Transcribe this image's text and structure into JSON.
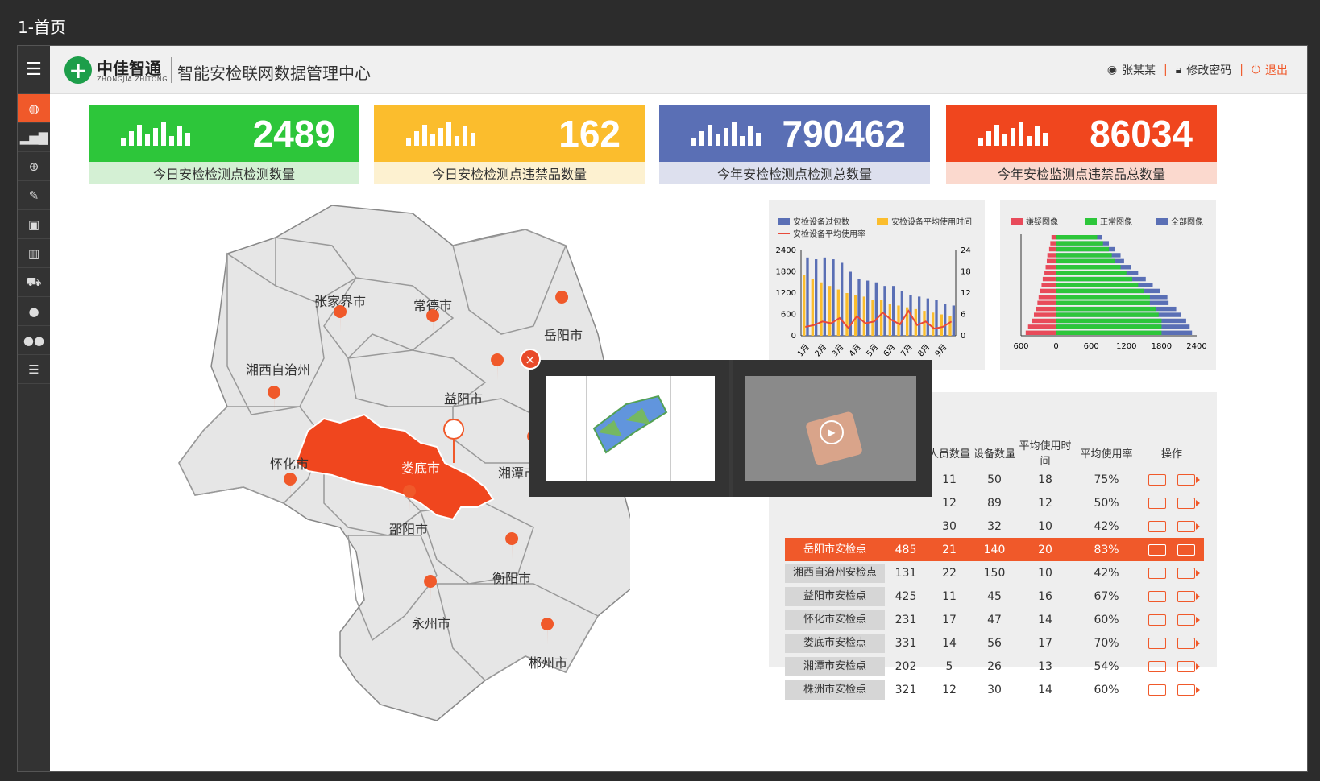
{
  "page_label": "1-首页",
  "header": {
    "logo_cn": "中佳智通",
    "logo_en": "ZHONGJIA ZHITONG",
    "system_title": "智能安检联网数据管理中心",
    "user_name": "张某某",
    "change_password": "修改密码",
    "logout": "退出"
  },
  "stats": [
    {
      "value": "2489",
      "label": "今日安检检测点检测数量",
      "color": "#2dc63a",
      "light": "#d4f0d4"
    },
    {
      "value": "162",
      "label": "今日安检检测点违禁品数量",
      "color": "#fbbd2d",
      "light": "#fdf1d0"
    },
    {
      "value": "790462",
      "label": "今年安检检测点检测总数量",
      "color": "#5a6fb5",
      "light": "#dde0ee"
    },
    {
      "value": "86034",
      "label": "今年安检监测点违禁品总数量",
      "color": "#f0461e",
      "light": "#fbd9ce"
    }
  ],
  "map": {
    "cities": [
      "张家界市",
      "常德市",
      "岳阳市",
      "湘西自治州",
      "益阳市",
      "怀化市",
      "娄底市",
      "湘潭市",
      "邵阳市",
      "衡阳市",
      "永州市",
      "郴州市"
    ],
    "selected": "娄底市",
    "highlight_color": "#f0461e"
  },
  "chart_data": [
    {
      "type": "bar",
      "legend": [
        "安检设备过包数",
        "安检设备平均使用时间",
        "安检设备平均使用率"
      ],
      "categories": [
        "1月",
        "2月",
        "3月",
        "4月",
        "5月",
        "6月",
        "7月",
        "8月",
        "9月"
      ],
      "series": [
        {
          "name": "安检设备过包数",
          "values": [
            2200,
            2150,
            2200,
            2150,
            2050,
            1800,
            1600,
            1550,
            1500,
            1400,
            1400,
            1250,
            1150,
            1100,
            1050,
            1000,
            900,
            850
          ],
          "color": "#5a6fb5"
        },
        {
          "name": "安检设备平均使用时间",
          "values": [
            17,
            16,
            15,
            14,
            13,
            12,
            11.5,
            11,
            10,
            10,
            9,
            8.5,
            8,
            7.5,
            7,
            6.5,
            6,
            5.5
          ],
          "color": "#fbbd2d"
        },
        {
          "name": "安检设备平均使用率",
          "values": [
            2.5,
            3,
            4,
            3.5,
            5,
            2.2,
            5.5,
            3.5,
            4,
            6.5,
            4.5,
            3.2,
            7,
            3,
            4,
            2,
            2.5,
            4
          ],
          "color": "#e84a3a"
        }
      ],
      "ylim_left": [
        0,
        2400
      ],
      "yticks_left": [
        "0",
        "600",
        "1200",
        "1800",
        "2400"
      ],
      "ylim_right": [
        0,
        24
      ],
      "yticks_right": [
        "0",
        "6",
        "12",
        "18",
        "24"
      ]
    },
    {
      "type": "bar",
      "orientation": "horizontal",
      "legend": [
        "嫌疑图像",
        "正常图像",
        "全部图像"
      ],
      "xticks": [
        "600",
        "0",
        "600",
        "1200",
        "1800",
        "2400"
      ],
      "series": [
        {
          "name": "嫌疑图像",
          "values": [
            -80,
            -100,
            -120,
            -150,
            -160,
            -180,
            -200,
            -230,
            -250,
            -280,
            -300,
            -320,
            -350,
            -380,
            -420,
            -480,
            -520
          ],
          "color": "#e84a5a"
        },
        {
          "name": "正常图像",
          "values": [
            700,
            800,
            900,
            950,
            1000,
            1100,
            1200,
            1300,
            1400,
            1500,
            1600,
            1600,
            1700,
            1750,
            1800,
            1800,
            1800
          ],
          "color": "#2dc63a"
        },
        {
          "name": "全部图像",
          "values": [
            780,
            900,
            1000,
            1100,
            1160,
            1280,
            1400,
            1530,
            1650,
            1780,
            1900,
            1920,
            2050,
            2130,
            2220,
            2280,
            2320
          ],
          "color": "#5a6fb5"
        }
      ]
    }
  ],
  "table": {
    "headers": [
      "",
      "",
      "人员数量",
      "设备数量",
      "平均使用时间",
      "平均使用率",
      "操作"
    ],
    "rows": [
      {
        "name": "",
        "a": "",
        "b": "11",
        "c": "50",
        "d": "18",
        "e": "75%"
      },
      {
        "name": "",
        "a": "",
        "b": "12",
        "c": "89",
        "d": "12",
        "e": "50%"
      },
      {
        "name": "",
        "a": "",
        "b": "30",
        "c": "32",
        "d": "10",
        "e": "42%"
      },
      {
        "name": "岳阳市安检点",
        "a": "485",
        "b": "21",
        "c": "140",
        "d": "20",
        "e": "83%"
      },
      {
        "name": "湘西自治州安检点",
        "a": "131",
        "b": "22",
        "c": "150",
        "d": "10",
        "e": "42%"
      },
      {
        "name": "益阳市安检点",
        "a": "425",
        "b": "11",
        "c": "45",
        "d": "16",
        "e": "67%"
      },
      {
        "name": "怀化市安检点",
        "a": "231",
        "b": "17",
        "c": "47",
        "d": "14",
        "e": "60%"
      },
      {
        "name": "娄底市安检点",
        "a": "331",
        "b": "14",
        "c": "56",
        "d": "17",
        "e": "70%"
      },
      {
        "name": "湘潭市安检点",
        "a": "202",
        "b": "5",
        "c": "26",
        "d": "13",
        "e": "54%"
      },
      {
        "name": "株洲市安检点",
        "a": "321",
        "b": "12",
        "c": "30",
        "d": "14",
        "e": "60%"
      }
    ]
  },
  "popup": {
    "close": "×"
  }
}
